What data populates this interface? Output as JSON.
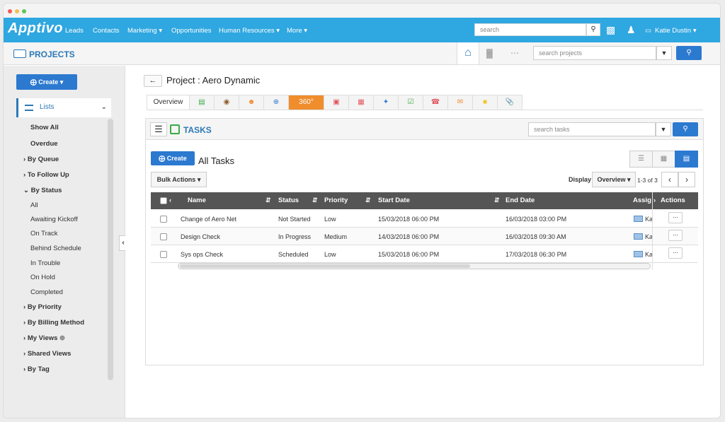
{
  "app": {
    "name": "Apptivo"
  },
  "topnav": {
    "items": [
      "Leads",
      "Contacts",
      "Marketing ▾",
      "Opportunities",
      "Human Resources ▾",
      "More ▾"
    ],
    "search_placeholder": "search",
    "user": "Katie Dustin ▾"
  },
  "module": {
    "title": "PROJECTS",
    "search_placeholder": "search projects"
  },
  "sidebar": {
    "create_label": "Create ▾",
    "lists_label": "Lists",
    "items": [
      {
        "label": "Show All",
        "bold": true
      },
      {
        "label": "Overdue",
        "bold": true
      },
      {
        "label": "By Queue",
        "bold": true,
        "arrow": "›"
      },
      {
        "label": "To Follow Up",
        "bold": true,
        "arrow": "›"
      },
      {
        "label": "By Status",
        "bold": true,
        "arrow": "⌄"
      },
      {
        "label": "All",
        "bold": false
      },
      {
        "label": "Awaiting Kickoff",
        "bold": false
      },
      {
        "label": "On Track",
        "bold": false
      },
      {
        "label": "Behind Schedule",
        "bold": false
      },
      {
        "label": "In Trouble",
        "bold": false
      },
      {
        "label": "On Hold",
        "bold": false
      },
      {
        "label": "Completed",
        "bold": false
      },
      {
        "label": "By Priority",
        "bold": true,
        "arrow": "›"
      },
      {
        "label": "By Billing Method",
        "bold": true,
        "arrow": "›"
      },
      {
        "label": "My Views",
        "bold": true,
        "arrow": "›"
      },
      {
        "label": "Shared Views",
        "bold": true,
        "arrow": "›"
      },
      {
        "label": "By Tag",
        "bold": true,
        "arrow": "›"
      }
    ]
  },
  "project": {
    "title": "Project : Aero Dynamic",
    "tabs": [
      "Overview",
      "notes-icon",
      "money-bag-icon",
      "team-icon",
      "globe-icon",
      "360°",
      "calendar-icon",
      "schedule-icon",
      "pin-icon",
      "tasks-icon",
      "phone-icon",
      "email-icon",
      "sticky-note-icon",
      "attachment-icon"
    ],
    "tab_360_label": "360°"
  },
  "tasks": {
    "title": "TASKS",
    "search_placeholder": "search tasks",
    "create_label": "Create",
    "heading": "All Tasks",
    "bulk_actions": "Bulk Actions ▾",
    "display_label": "Display",
    "display_value": "Overview ▾",
    "page_info": "1-3 of 3",
    "columns": [
      "Name",
      "Status",
      "Priority",
      "Start Date",
      "End Date",
      "Assig",
      "Actions"
    ],
    "rows": [
      {
        "name": "Change of Aero Net",
        "status": "Not Started",
        "priority": "Low",
        "start": "15/03/2018 06:00 PM",
        "end": "16/03/2018 03:00 PM",
        "assignee": "Ka"
      },
      {
        "name": "Design Check",
        "status": "In Progress",
        "priority": "Medium",
        "start": "14/03/2018 06:00 PM",
        "end": "16/03/2018 09:30 AM",
        "assignee": "Ka"
      },
      {
        "name": "Sys ops Check",
        "status": "Scheduled",
        "priority": "Low",
        "start": "15/03/2018 06:00 PM",
        "end": "17/03/2018 06:30 PM",
        "assignee": "Ka"
      }
    ]
  },
  "colors": {
    "nav_blue": "#2fa7e0",
    "primary": "#2c79d0",
    "tab_active": "#f08d2c"
  }
}
